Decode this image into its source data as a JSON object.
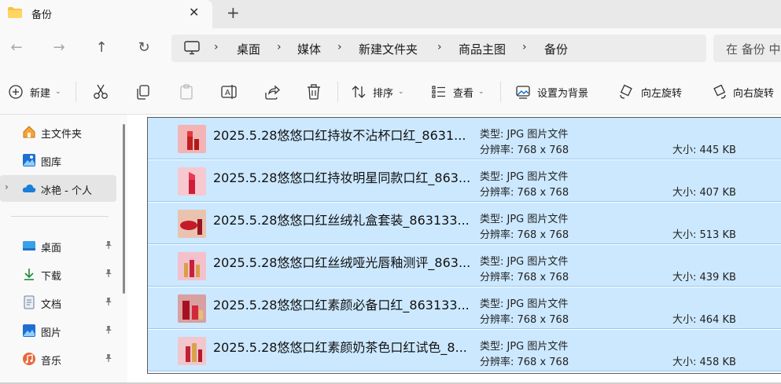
{
  "tab": {
    "title": "备份",
    "close_glyph": "✕",
    "add_glyph": "+"
  },
  "nav": {
    "back_glyph": "←",
    "forward_glyph": "→",
    "up_glyph": "↑",
    "refresh_glyph": "↻",
    "breadcrumbs": [
      "桌面",
      "媒体",
      "新建文件夹",
      "商品主图",
      "备份"
    ],
    "separator": "›",
    "search_placeholder": "在 备份 中"
  },
  "toolbar": {
    "new_label": "新建",
    "sort_label": "排序",
    "view_label": "查看",
    "set_background_label": "设置为背景",
    "rotate_left_label": "向左旋转",
    "rotate_right_label": "向右旋转",
    "chevron": "⌄"
  },
  "sidebar": {
    "items": [
      {
        "label": "主文件夹",
        "icon": "home-icon"
      },
      {
        "label": "图库",
        "icon": "gallery-icon"
      },
      {
        "label": "冰艳 - 个人",
        "icon": "onedrive-cloud-icon",
        "expand": "›"
      },
      {
        "label": "桌面",
        "icon": "desktop-icon"
      },
      {
        "label": "下载",
        "icon": "download-icon"
      },
      {
        "label": "文档",
        "icon": "document-icon"
      },
      {
        "label": "图片",
        "icon": "pictures-icon"
      },
      {
        "label": "音乐",
        "icon": "music-icon"
      }
    ]
  },
  "files": [
    {
      "name": "2025.5.28悠悠口红持妆不沾杯口红_8631...",
      "type": "类型: JPG 图片文件",
      "resolution": "分辨率: 768 x 768",
      "size": "大小: 445 KB"
    },
    {
      "name": "2025.5.28悠悠口红持妆明星同款口红_863...",
      "type": "类型: JPG 图片文件",
      "resolution": "分辨率: 768 x 768",
      "size": "大小: 407 KB"
    },
    {
      "name": "2025.5.28悠悠口红丝绒礼盒套装_863133...",
      "type": "类型: JPG 图片文件",
      "resolution": "分辨率: 768 x 768",
      "size": "大小: 513 KB"
    },
    {
      "name": "2025.5.28悠悠口红丝绒哑光唇釉测评_863...",
      "type": "类型: JPG 图片文件",
      "resolution": "分辨率: 768 x 768",
      "size": "大小: 439 KB"
    },
    {
      "name": "2025.5.28悠悠口红素颜必备口红_863133...",
      "type": "类型: JPG 图片文件",
      "resolution": "分辨率: 768 x 768",
      "size": "大小: 464 KB"
    },
    {
      "name": "2025.5.28悠悠口红素颜奶茶色口红试色_8...",
      "type": "类型: JPG 图片文件",
      "resolution": "分辨率: 768 x 768",
      "size": "大小: 458 KB"
    }
  ],
  "colors": {
    "selection": "#cce8ff",
    "accent": "#0067c0",
    "folder": "#f4c542"
  }
}
